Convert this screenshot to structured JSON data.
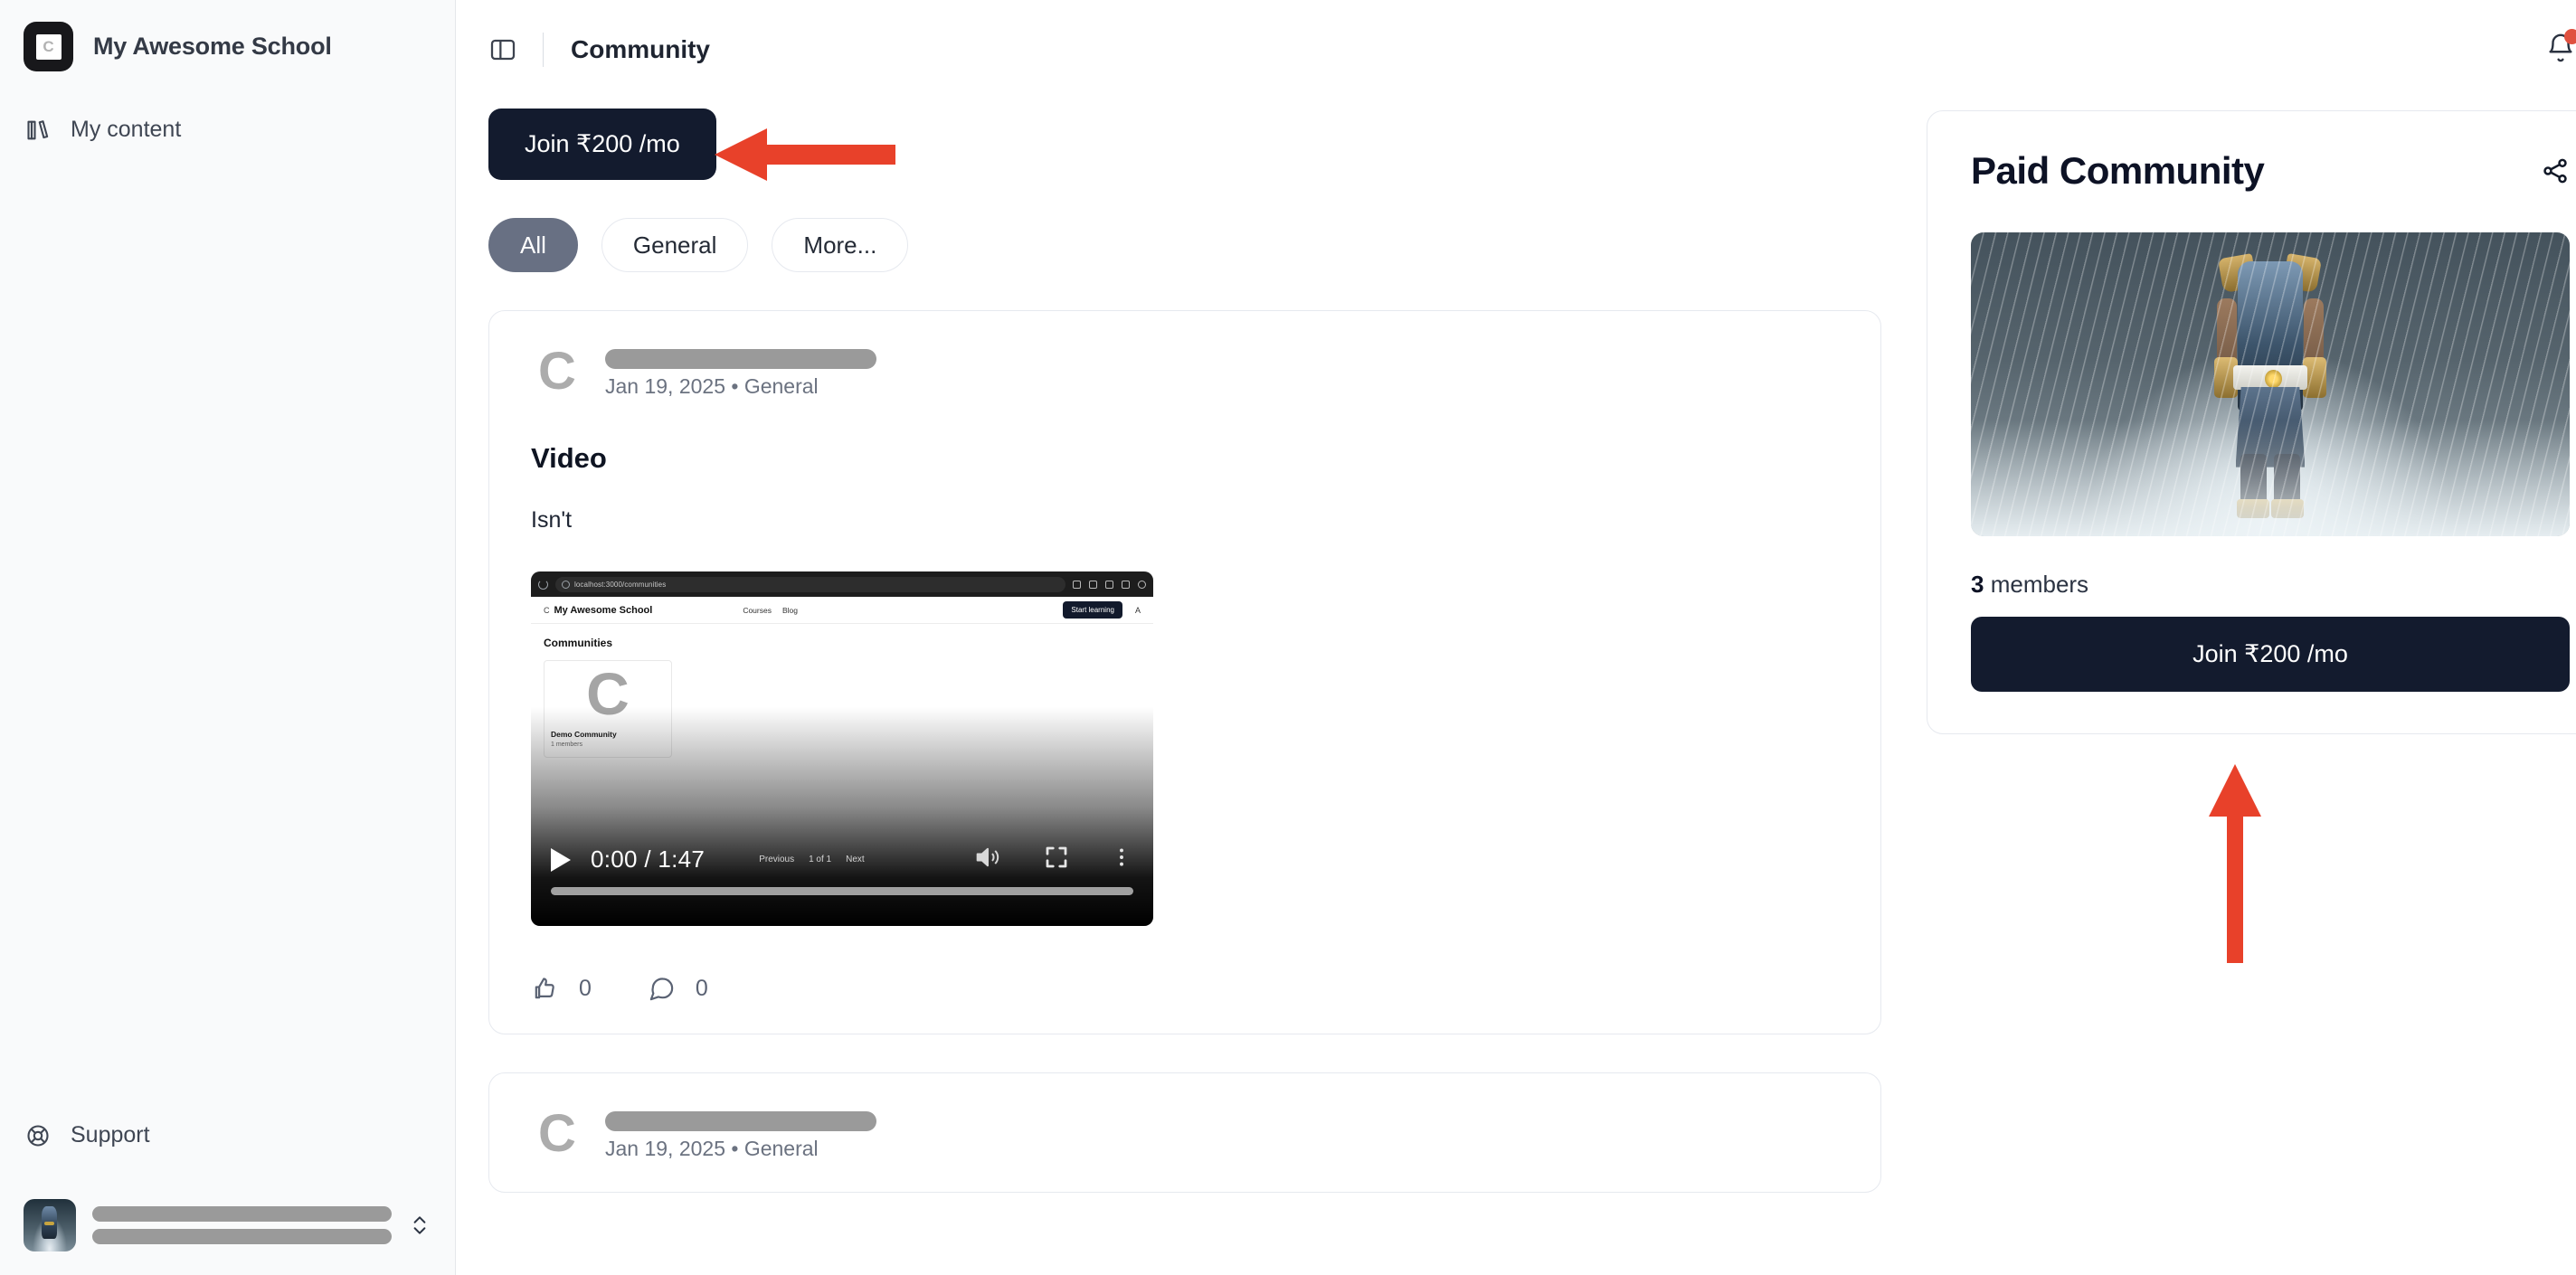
{
  "sidebar": {
    "brand": {
      "logo_glyph": "C",
      "name": "My Awesome School"
    },
    "items": [
      {
        "label": "My content",
        "icon": "library-icon"
      }
    ],
    "support": {
      "label": "Support",
      "icon": "lifebuoy-icon"
    },
    "user": {
      "name_redacted": "",
      "handle_redacted": "",
      "selector_icon": "chevrons-up-down-icon"
    }
  },
  "topbar": {
    "panel_toggle_icon": "sidebar-toggle-icon",
    "title": "Community",
    "bell_icon": "bell-icon",
    "has_notification": true
  },
  "main": {
    "join_button_label": "Join ₹200 /mo",
    "filters": [
      {
        "label": "All",
        "active": true
      },
      {
        "label": "General",
        "active": false
      },
      {
        "label": "More...",
        "active": false
      }
    ],
    "posts": [
      {
        "avatar_glyph": "C",
        "author_redacted": "",
        "meta": "Jan 19, 2025 • General",
        "title": "Video",
        "body": "Isn't",
        "video": {
          "current_time": "0:00",
          "duration": "1:47",
          "time_display": "0:00 / 1:47",
          "prev_label": "Previous",
          "page_indicator": "1 of 1",
          "next_label": "Next",
          "play_icon": "play-icon",
          "volume_icon": "volume-icon",
          "fullscreen_icon": "fullscreen-icon",
          "more_icon": "more-vertical-icon",
          "screenshot": {
            "url": "localhost:3000/communities",
            "brand": "My Awesome School",
            "nav": [
              "Courses",
              "Blog"
            ],
            "cta": "Start learning",
            "account_glyph": "A",
            "heading": "Communities",
            "card": {
              "logo_glyph": "C",
              "name": "Demo Community",
              "members": "1 members"
            }
          }
        },
        "actions": {
          "like_icon": "thumbs-up-icon",
          "like_count": "0",
          "comment_icon": "comment-icon",
          "comment_count": "0"
        }
      },
      {
        "avatar_glyph": "C",
        "author_redacted": "",
        "meta": "Jan 19, 2025 • General"
      }
    ]
  },
  "right": {
    "card": {
      "title": "Paid Community",
      "share_icon": "share-icon",
      "members_count": "3",
      "members_label": "members",
      "join_button_label": "Join ₹200 /mo"
    }
  },
  "annotations": {
    "color": "#e8412a",
    "arrow_to_top_join": "arrow-left",
    "arrow_to_side_join": "arrow-up"
  }
}
